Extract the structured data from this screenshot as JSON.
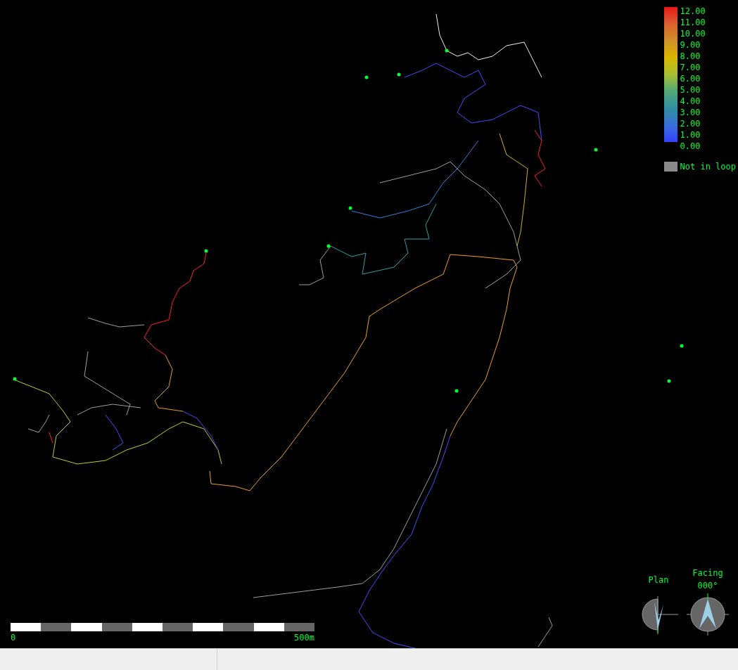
{
  "legend": {
    "labels": [
      "12.00",
      "11.00",
      "10.00",
      "9.00",
      "8.00",
      "7.00",
      "6.00",
      "5.00",
      "4.00",
      "3.00",
      "2.00",
      "1.00",
      "0.00"
    ],
    "not_in_loop": "Not in loop"
  },
  "scale_bar": {
    "start": "0",
    "end": "500m"
  },
  "plan": {
    "label": "Plan"
  },
  "facing": {
    "label": "Facing",
    "bearing": "000°"
  }
}
